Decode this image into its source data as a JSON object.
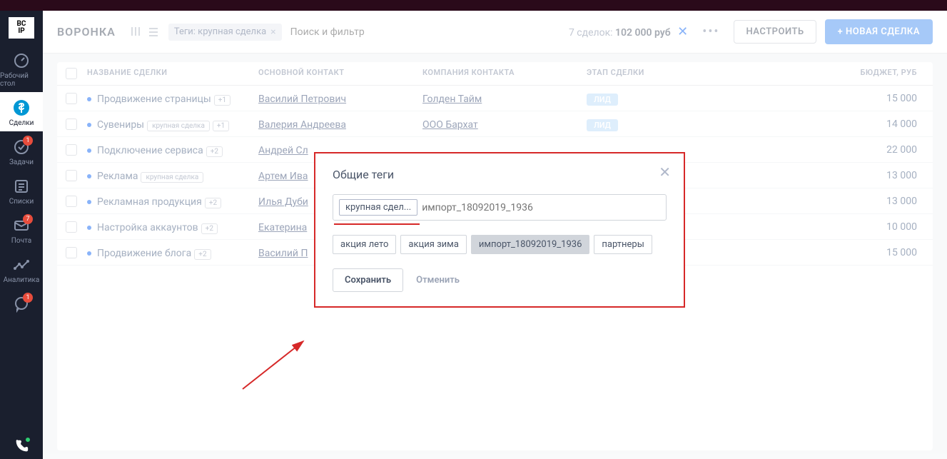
{
  "logo": {
    "l1": "BC",
    "l2": "IP"
  },
  "sidebar": [
    {
      "label": "Рабочий стол"
    },
    {
      "label": "Сделки"
    },
    {
      "label": "Задачи",
      "badge": "1"
    },
    {
      "label": "Списки"
    },
    {
      "label": "Почта",
      "badge": "7"
    },
    {
      "label": "Аналитика"
    },
    {
      "label": "",
      "badge": "1"
    }
  ],
  "header": {
    "title": "ВОРОНКА",
    "tag": "Теги: крупная сделка",
    "search_placeholder": "Поиск и фильтр",
    "stats_count": "7 сделок:",
    "stats_amount": "102 000 руб",
    "settings": "НАСТРОИТЬ",
    "new": "+ НОВАЯ СДЕЛКА"
  },
  "columns": {
    "name": "НАЗВАНИЕ СДЕЛКИ",
    "contact": "ОСНОВНОЙ КОНТАКТ",
    "company": "КОМПАНИЯ КОНТАКТА",
    "stage": "ЭТАП СДЕЛКИ",
    "budget": "БЮДЖЕТ, РУБ"
  },
  "deals": [
    {
      "name": "Продвижение страницы",
      "tag": "",
      "count": "+1",
      "contact": "Василий Петрович",
      "company": "Голден Тайм",
      "stage": "ЛИД",
      "budget": "15 000"
    },
    {
      "name": "Сувениры",
      "tag": "крупная сделка",
      "count": "+1",
      "contact": "Валерия Андреева",
      "company": "ООО Бархат",
      "stage": "ЛИД",
      "budget": "14 000"
    },
    {
      "name": "Подключение сервиса",
      "tag": "",
      "count": "+2",
      "contact": "Андрей Сл",
      "company": "",
      "stage": "",
      "budget": "22 000"
    },
    {
      "name": "Реклама",
      "tag": "крупная сделка",
      "count": "",
      "contact": "Артем Ива",
      "company": "",
      "stage": "",
      "budget": "13 000"
    },
    {
      "name": "Рекламная продукция",
      "tag": "",
      "count": "+2",
      "contact": "Илья Дуби",
      "company": "",
      "stage": "",
      "budget": "13 000"
    },
    {
      "name": "Настройка аккаунтов",
      "tag": "",
      "count": "+2",
      "contact": "Екатерина",
      "company": "",
      "stage": "",
      "budget": "10 000"
    },
    {
      "name": "Продвижение блога",
      "tag": "",
      "count": "+2",
      "contact": "Василий П",
      "company": "",
      "stage": "",
      "budget": "15 000"
    }
  ],
  "modal": {
    "title": "Общие теги",
    "selected_tag": "крупная сдел...",
    "input_placeholder": "импорт_18092019_1936",
    "suggestions": [
      "акция лето",
      "акция зима",
      "импорт_18092019_1936",
      "партнеры"
    ],
    "save": "Сохранить",
    "cancel": "Отменить"
  }
}
